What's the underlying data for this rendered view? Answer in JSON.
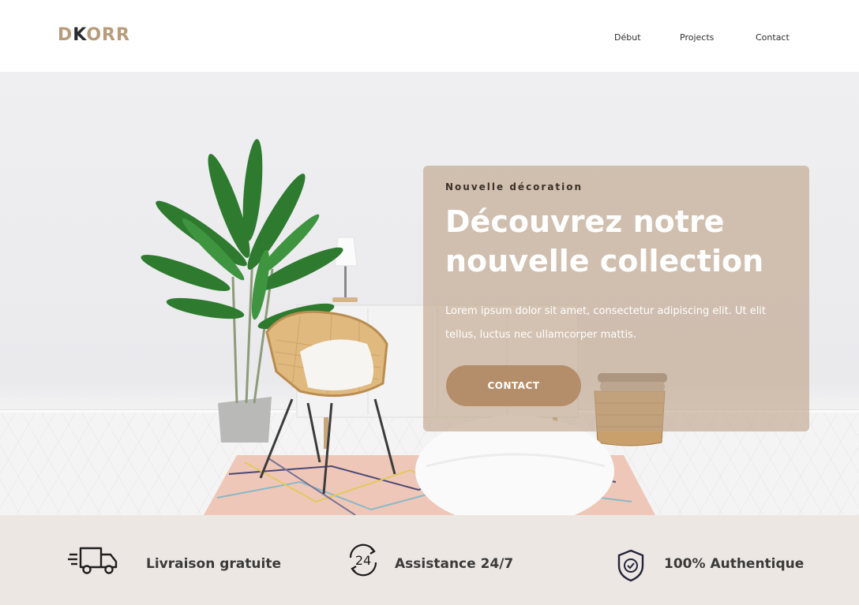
{
  "brand": {
    "part1": "D",
    "part2": "K",
    "part3": "ORR",
    "accent": "#b79b7b",
    "dark": "#2b2b2b"
  },
  "nav": {
    "items": [
      "Début",
      "Projects",
      "Contact"
    ]
  },
  "hero": {
    "eyebrow": "Nouvelle décoration",
    "title": "Découvrez notre nouvelle collection",
    "description": "Lorem ipsum dolor sit amet, consectetur adipiscing elit. Ut elit tellus, luctus nec ullamcorper mattis.",
    "cta_label": "CONTACT",
    "cta_color": "#b48e6a"
  },
  "features": [
    {
      "icon": "delivery-truck-icon",
      "label": "Livraison gratuite"
    },
    {
      "icon": "support-24-icon",
      "label": "Assistance 24/7"
    },
    {
      "icon": "shield-check-icon",
      "label": "100% Authentique"
    }
  ]
}
